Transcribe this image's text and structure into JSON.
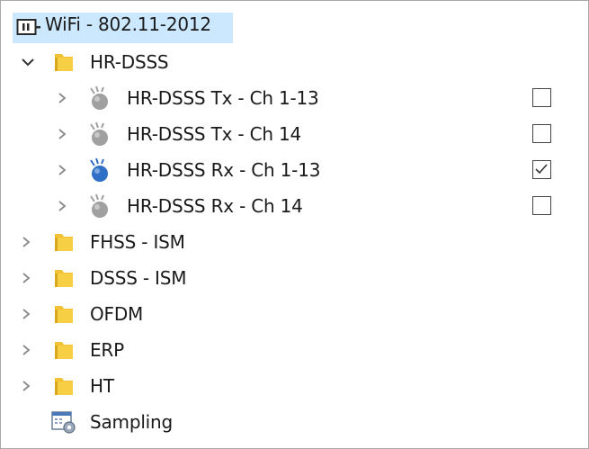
{
  "colors": {
    "selection": "#cce8ff",
    "folder": "#f2c233",
    "active_signal": "#2f6fc5",
    "inactive_signal": "#a0a0a0"
  },
  "tree": {
    "root": {
      "label": "WiFi - 802.11-2012",
      "icon": "device-icon"
    },
    "group": {
      "label": "HR-DSSS",
      "icon": "folder-icon",
      "expanded": true,
      "children": [
        {
          "label": "HR-DSSS Tx - Ch 1-13",
          "checked": false,
          "icon": "signal-icon"
        },
        {
          "label": "HR-DSSS Tx - Ch 14",
          "checked": false,
          "icon": "signal-icon"
        },
        {
          "label": "HR-DSSS Rx - Ch 1-13",
          "checked": true,
          "icon": "signal-icon"
        },
        {
          "label": "HR-DSSS Rx - Ch 14",
          "checked": false,
          "icon": "signal-icon"
        }
      ]
    },
    "folders": [
      {
        "label": "FHSS - ISM"
      },
      {
        "label": "DSSS - ISM"
      },
      {
        "label": "OFDM"
      },
      {
        "label": "ERP"
      },
      {
        "label": "HT"
      }
    ],
    "sampling": {
      "label": "Sampling",
      "icon": "sampling-icon"
    }
  }
}
